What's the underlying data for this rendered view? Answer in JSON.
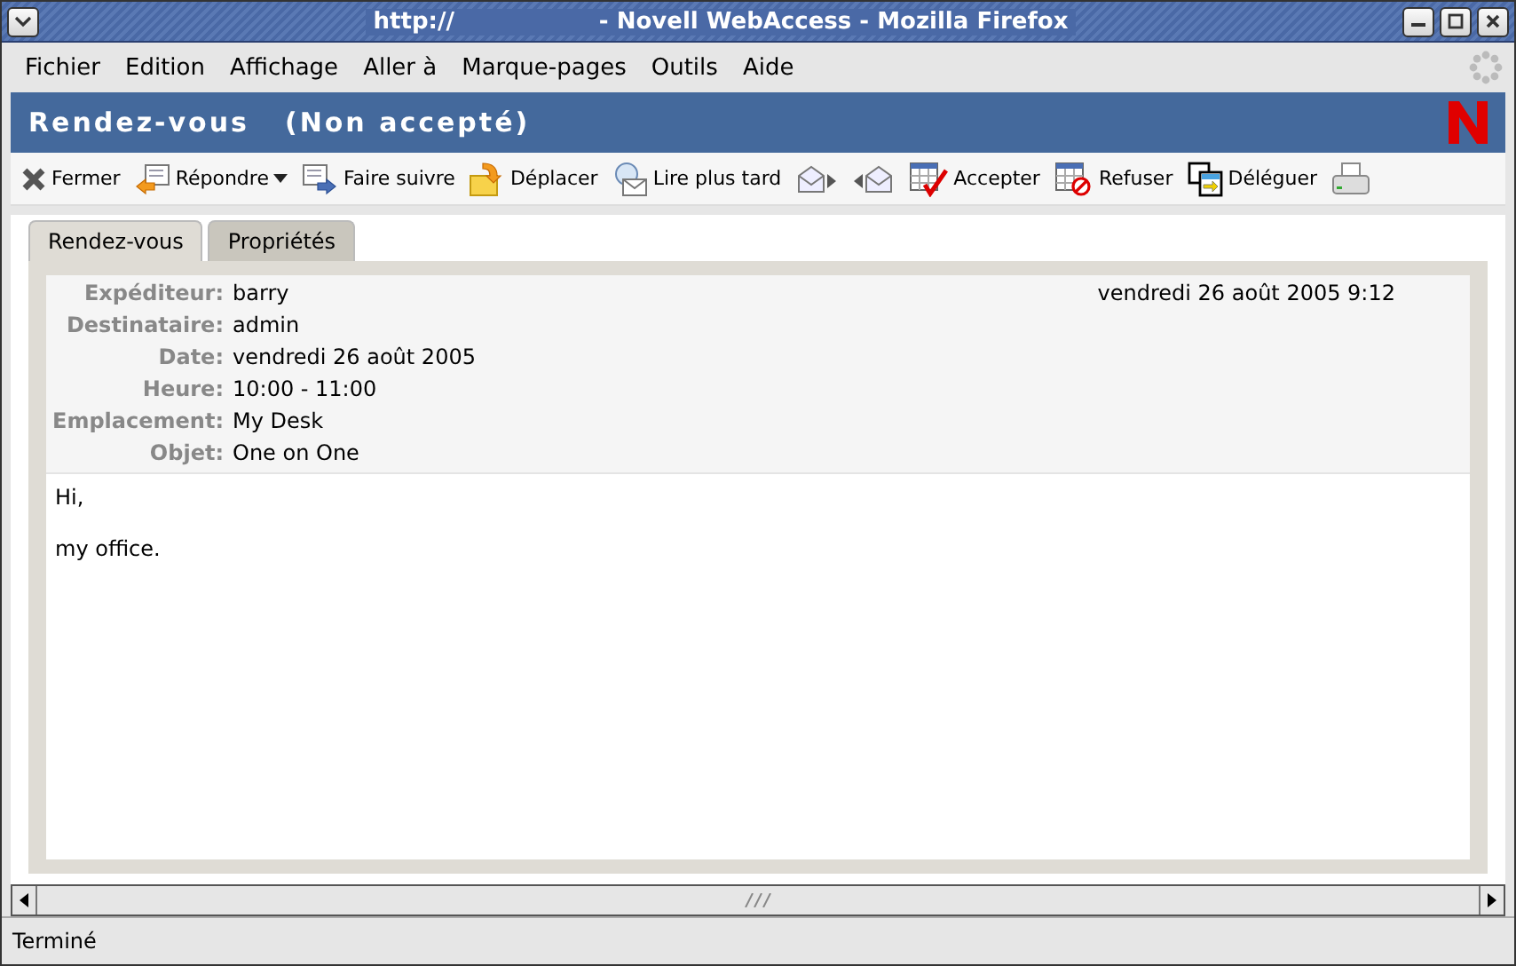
{
  "window": {
    "title": "http://                  - Novell WebAccess - Mozilla Firefox"
  },
  "menu": [
    "Fichier",
    "Edition",
    "Affichage",
    "Aller à",
    "Marque-pages",
    "Outils",
    "Aide"
  ],
  "header": {
    "title": "Rendez-vous",
    "status": "(Non accepté)"
  },
  "toolbar": [
    {
      "label": "Fermer",
      "has_menu": false
    },
    {
      "label": "Répondre",
      "has_menu": true
    },
    {
      "label": "Faire suivre",
      "has_menu": false
    },
    {
      "label": "Déplacer",
      "has_menu": false
    },
    {
      "label": "Lire plus tard",
      "has_menu": false
    },
    {
      "has_menu": false
    },
    {
      "has_menu": false
    },
    {
      "label": "Accepter",
      "has_menu": false
    },
    {
      "label": "Refuser",
      "has_menu": false
    },
    {
      "label": "Déléguer",
      "has_menu": false
    },
    {
      "has_menu": false
    }
  ],
  "tabs": [
    {
      "label": "Rendez-vous",
      "selected": true
    },
    {
      "label": "Propriétés",
      "selected": false
    }
  ],
  "message": {
    "sent": "vendredi 26 août 2005 9:12",
    "fields": [
      {
        "label": "Expéditeur:",
        "value": "barry"
      },
      {
        "label": "Destinataire:",
        "value": "admin"
      },
      {
        "label": "Date:",
        "value": "vendredi 26 août 2005"
      },
      {
        "label": "Heure:",
        "value": "10:00 - 11:00"
      },
      {
        "label": "Emplacement:",
        "value": "My Desk"
      },
      {
        "label": "Objet:",
        "value": "One on One"
      }
    ],
    "body": [
      "Hi,",
      "my office."
    ]
  },
  "status_bar": "Terminé"
}
